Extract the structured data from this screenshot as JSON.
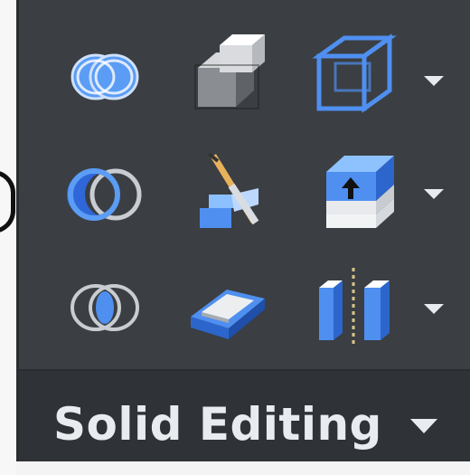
{
  "panel": {
    "title": "Solid Editing"
  },
  "tools": [
    {
      "row": 1,
      "col": 1,
      "icon": "union-icon"
    },
    {
      "row": 1,
      "col": 2,
      "icon": "extrude-faces-icon"
    },
    {
      "row": 1,
      "col": 3,
      "icon": "wireframe-box-icon"
    },
    {
      "row": 2,
      "col": 1,
      "icon": "subtract-icon"
    },
    {
      "row": 2,
      "col": 2,
      "icon": "slice-icon"
    },
    {
      "row": 2,
      "col": 3,
      "icon": "imprint-icon"
    },
    {
      "row": 3,
      "col": 1,
      "icon": "intersect-icon"
    },
    {
      "row": 3,
      "col": 2,
      "icon": "shell-icon"
    },
    {
      "row": 3,
      "col": 3,
      "icon": "separate-icon"
    }
  ],
  "colors": {
    "panel_bg": "#3b3e42",
    "title_bar_bg": "#2f3236",
    "accent_blue": "#4f8ff0",
    "title_text": "#e9ecef"
  }
}
